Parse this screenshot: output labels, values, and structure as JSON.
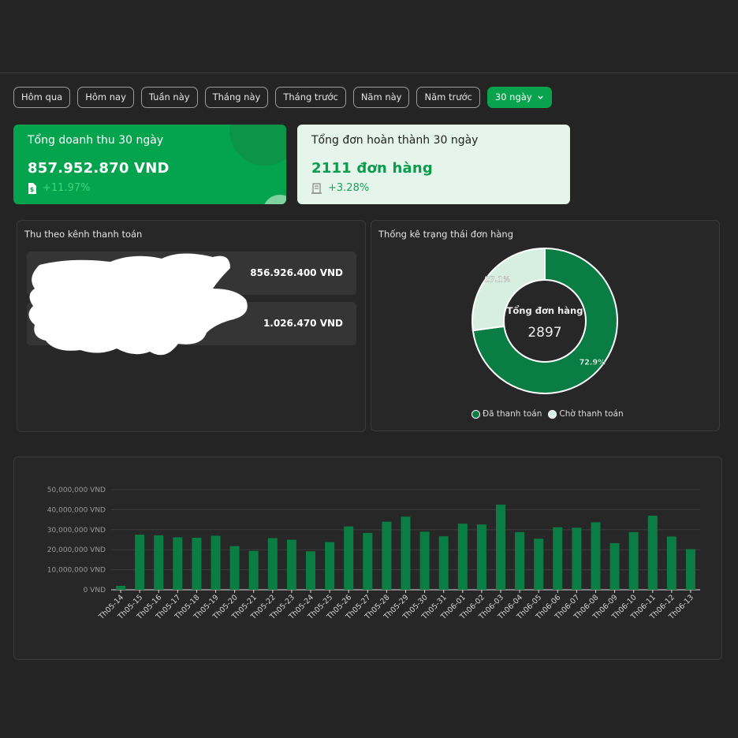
{
  "filters": {
    "items": [
      "Hôm qua",
      "Hôm nay",
      "Tuần này",
      "Tháng này",
      "Tháng trước",
      "Năm này",
      "Năm trước"
    ],
    "active": "30 ngày"
  },
  "kpi_revenue": {
    "title": "Tổng doanh thu 30 ngày",
    "value": "857.952.870 VND",
    "delta": "+11.97%"
  },
  "kpi_orders": {
    "title": "Tổng đơn hoàn thành 30 ngày",
    "value": "2111 đơn hàng",
    "delta": "+3.28%"
  },
  "payment_channels": {
    "title": "Thu theo kênh thanh toán",
    "rows": [
      {
        "name": "",
        "amount": "856.926.400 VND"
      },
      {
        "name": "",
        "amount": "1.026.470 VND"
      }
    ]
  },
  "order_status": {
    "title": "Thống kê trạng thái đơn hàng",
    "center_label": "Tổng đơn hàng",
    "center_value": "2897",
    "slices": [
      {
        "name": "Đã thanh toán",
        "percent": 72.9,
        "label": "72.9%",
        "color": "#0a7d44"
      },
      {
        "name": "Chờ thanh toán",
        "percent": 27.1,
        "label": "27.1%",
        "color": "#d6efe0"
      }
    ]
  },
  "colors": {
    "accent": "#04a34e",
    "bar": "#0a7d44",
    "background": "#242424"
  },
  "chart_data": {
    "type": "bar",
    "categories": [
      "Th05-14",
      "Th05-15",
      "Th05-16",
      "Th05-17",
      "Th05-18",
      "Th05-19",
      "Th05-20",
      "Th05-21",
      "Th05-22",
      "Th05-23",
      "Th05-24",
      "Th05-25",
      "Th05-26",
      "Th05-27",
      "Th05-28",
      "Th05-29",
      "Th05-30",
      "Th05-31",
      "Th06-01",
      "Th06-02",
      "Th06-03",
      "Th06-04",
      "Th06-05",
      "Th06-06",
      "Th06-07",
      "Th06-08",
      "Th06-09",
      "Th06-10",
      "Th06-11",
      "Th06-12",
      "Th06-13"
    ],
    "values": [
      2000000,
      27500000,
      27200000,
      26200000,
      26000000,
      27000000,
      21800000,
      19400000,
      25800000,
      25000000,
      19200000,
      23800000,
      31600000,
      28400000,
      34000000,
      36500000,
      29000000,
      26700000,
      33000000,
      32600000,
      42500000,
      28800000,
      25500000,
      31200000,
      31000000,
      33700000,
      23300000,
      28800000,
      37000000,
      26600000,
      20300000
    ],
    "yticks": [
      "0 VND",
      "10,000,000 VND",
      "20,000,000 VND",
      "30,000,000 VND",
      "40,000,000 VND",
      "50,000,000 VND"
    ],
    "ylim": [
      0,
      50000000
    ],
    "grid": true
  }
}
